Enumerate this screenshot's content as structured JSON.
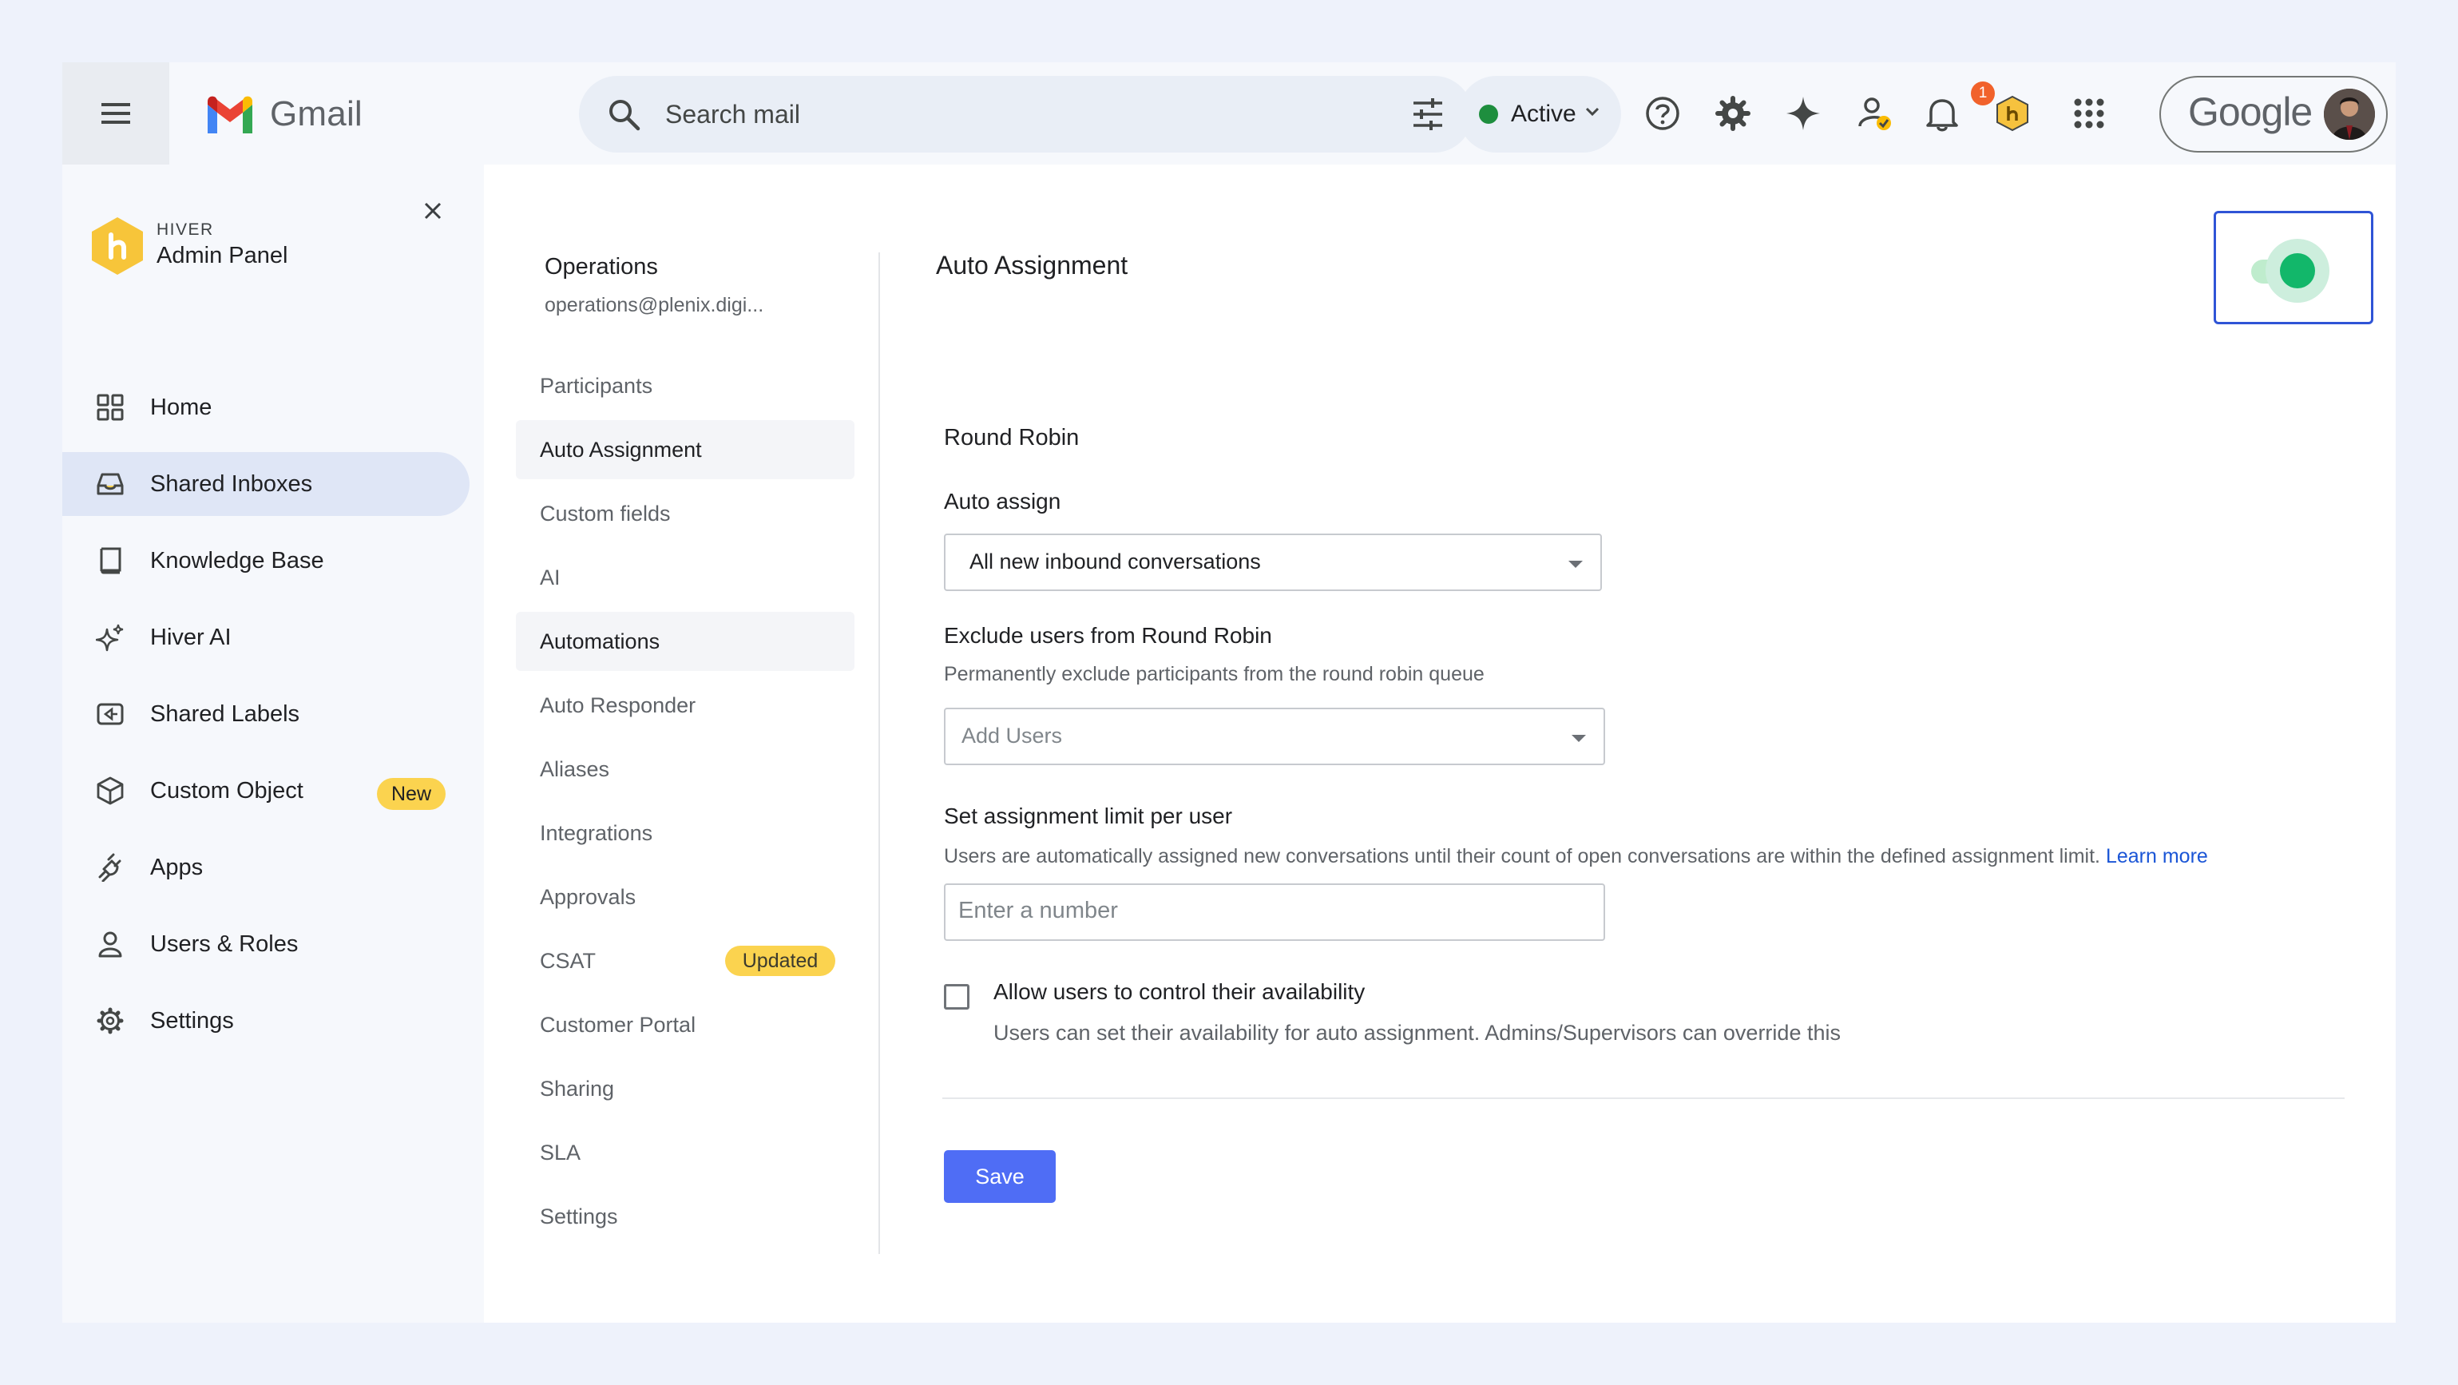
{
  "topbar": {
    "app_name": "Gmail",
    "search_placeholder": "Search mail",
    "status_label": "Active",
    "notification_count": "1",
    "google_label": "Google"
  },
  "sidebar": {
    "brand_small": "HIVER",
    "brand_title": "Admin Panel",
    "items": [
      {
        "label": "Home",
        "icon": "grid-icon"
      },
      {
        "label": "Shared Inboxes",
        "icon": "inbox-icon",
        "active": true
      },
      {
        "label": "Knowledge Base",
        "icon": "book-icon"
      },
      {
        "label": "Hiver AI",
        "icon": "sparkle-icon"
      },
      {
        "label": "Shared Labels",
        "icon": "label-icon"
      },
      {
        "label": "Custom Object",
        "icon": "cube-icon",
        "badge": "New"
      },
      {
        "label": "Apps",
        "icon": "plug-icon"
      },
      {
        "label": "Users & Roles",
        "icon": "user-icon"
      },
      {
        "label": "Settings",
        "icon": "gear-icon"
      }
    ]
  },
  "inbox": {
    "name": "Operations",
    "email": "operations@plenix.digi..."
  },
  "subnav": [
    {
      "label": "Participants"
    },
    {
      "label": "Auto Assignment",
      "selected": true
    },
    {
      "label": "Custom fields"
    },
    {
      "label": "AI"
    },
    {
      "label": "Automations",
      "highlighted": true
    },
    {
      "label": "Auto Responder"
    },
    {
      "label": "Aliases"
    },
    {
      "label": "Integrations"
    },
    {
      "label": "Approvals"
    },
    {
      "label": "CSAT",
      "badge": "Updated"
    },
    {
      "label": "Customer Portal"
    },
    {
      "label": "Sharing"
    },
    {
      "label": "SLA"
    },
    {
      "label": "Settings"
    }
  ],
  "main": {
    "title": "Auto Assignment",
    "toggle_on": true,
    "method": "Round Robin",
    "auto_assign_label": "Auto assign",
    "auto_assign_value": "All new inbound conversations",
    "exclude_label": "Exclude users from Round Robin",
    "exclude_help": "Permanently exclude participants from the round robin queue",
    "exclude_placeholder": "Add Users",
    "limit_label": "Set assignment limit per user",
    "limit_help": "Users are automatically assigned new conversations until their count of open conversations are within the defined assignment limit.",
    "learn_more": "Learn more",
    "limit_placeholder": "Enter a number",
    "availability_label": "Allow users to control their availability",
    "availability_help": "Users can set their availability for auto assignment. Admins/Supervisors can override this",
    "save_label": "Save"
  },
  "colors": {
    "accent": "#4f6df5",
    "toggle": "#12b76a",
    "badge": "#fbd34f",
    "link": "#1a55d6"
  }
}
